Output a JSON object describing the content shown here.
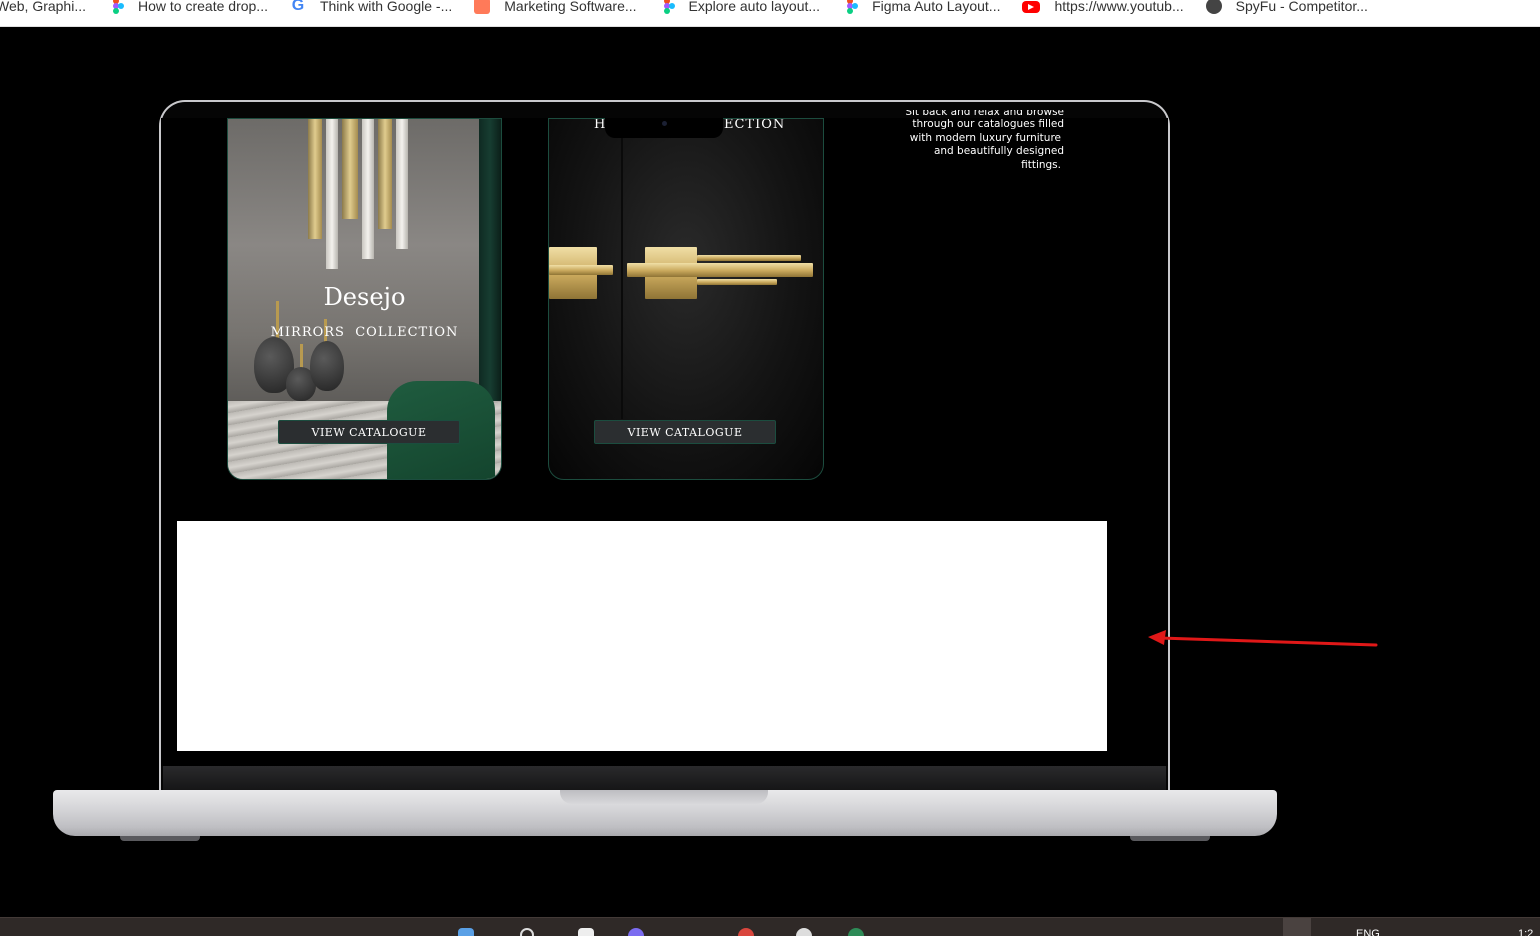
{
  "bookmarks": [
    {
      "label": "Web, Graphi...",
      "icon": "figma-icon"
    },
    {
      "label": "How to create drop...",
      "icon": "figma-icon"
    },
    {
      "label": "Think with Google -...",
      "icon": "google-icon"
    },
    {
      "label": "Marketing Software...",
      "icon": "hubspot-icon"
    },
    {
      "label": "Explore auto layout...",
      "icon": "figma-icon"
    },
    {
      "label": "Figma Auto Layout...",
      "icon": "figma-icon"
    },
    {
      "label": "https://www.youtub...",
      "icon": "youtube-icon"
    },
    {
      "label": "SpyFu - Competitor...",
      "icon": "spyfu-icon"
    }
  ],
  "cards": [
    {
      "brand": "Desejo",
      "collection": "MIRRORS  COLLECTION",
      "cta": "VIEW CATALOGUE"
    },
    {
      "collection_left": "H",
      "collection_right": "ECTION",
      "cta": "VIEW CATALOGUE"
    }
  ],
  "intro": {
    "partial_line": "Sit back and relax and browse",
    "lines": [
      "through our catalogues filled",
      "with modern luxury furniture",
      "and beautifully designed",
      "fittings."
    ]
  },
  "taskbar": {
    "language": "ENG",
    "time": "1:2"
  },
  "colors": {
    "background": "#000000",
    "card_border": "#1c4c3e",
    "button": "#2b2e30",
    "arrow": "#e01818"
  }
}
